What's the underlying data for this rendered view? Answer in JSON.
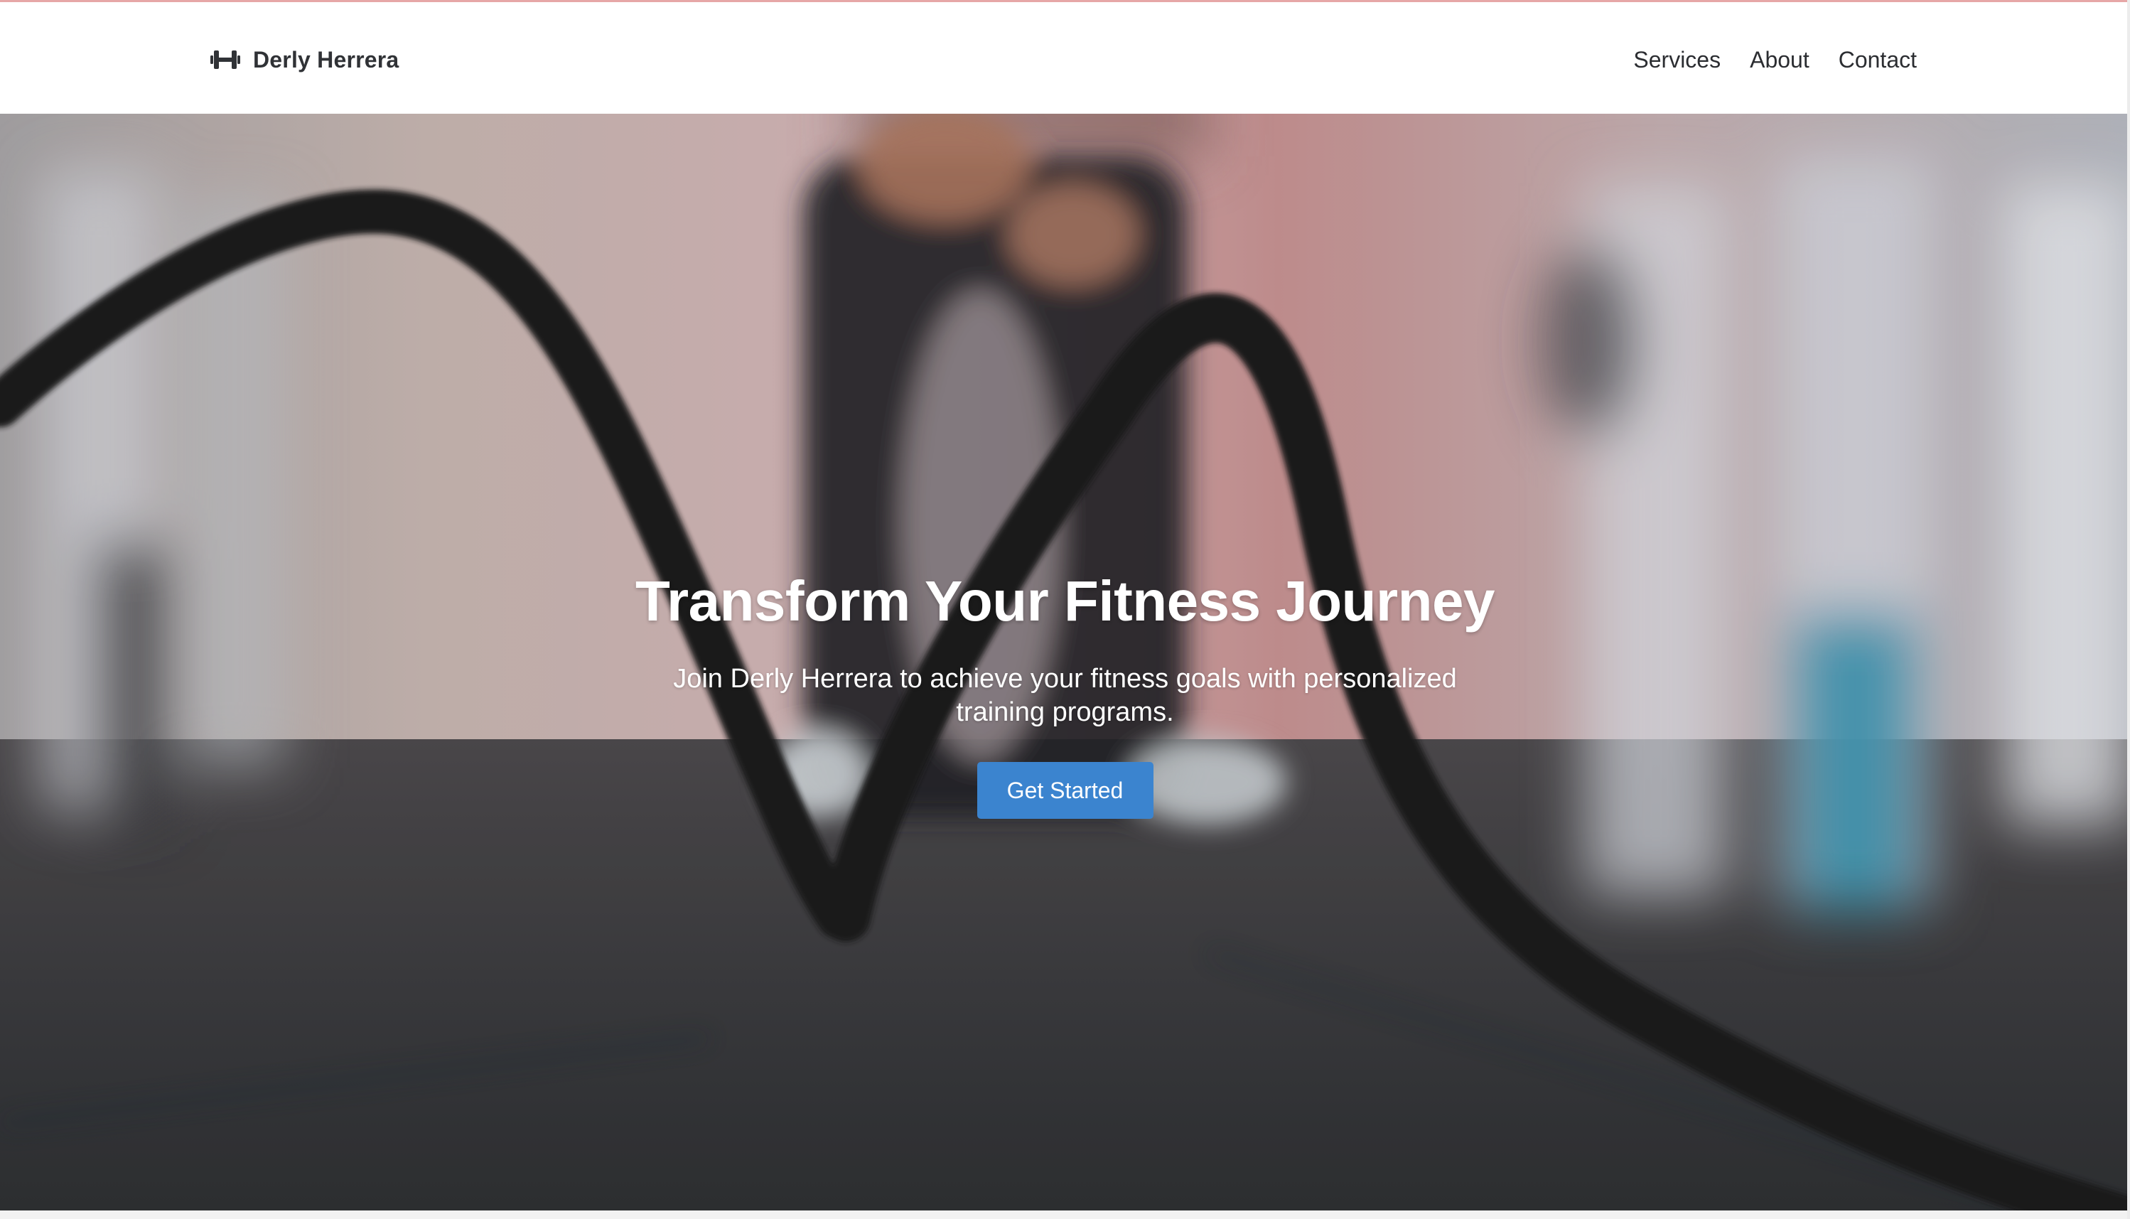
{
  "brand": {
    "icon": "dumbbell-icon",
    "name": "Derly Herrera"
  },
  "nav": {
    "items": [
      "Services",
      "About",
      "Contact"
    ]
  },
  "hero": {
    "title": "Transform Your Fitness Journey",
    "subtitle": "Join Derly Herrera to achieve your fitness goals with personalized training programs.",
    "cta_label": "Get Started"
  },
  "colors": {
    "accent": "#3b84cf",
    "header_bg": "#ffffff",
    "text_dark": "#2b2d31"
  }
}
